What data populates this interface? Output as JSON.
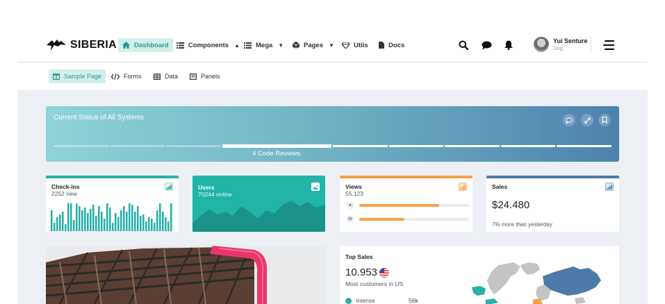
{
  "brand": {
    "name": "SIBERIA"
  },
  "nav": [
    {
      "label": "Dashboard",
      "icon": "home-icon",
      "active": true
    },
    {
      "label": "Components",
      "icon": "list-icon",
      "caret": "up"
    },
    {
      "label": "Mega",
      "icon": "list-icon",
      "caret": "down"
    },
    {
      "label": "Pages",
      "icon": "cube-icon",
      "caret": "down"
    },
    {
      "label": "Utils",
      "icon": "diamond-icon"
    },
    {
      "label": "Docs",
      "icon": "document-icon"
    }
  ],
  "user": {
    "name": "Yui Senture",
    "role": "Dog"
  },
  "subnav": [
    {
      "label": "Sample Page",
      "icon": "columns-icon",
      "active": true
    },
    {
      "label": "Forms",
      "icon": "code-icon"
    },
    {
      "label": "Data",
      "icon": "table-icon"
    },
    {
      "label": "Panels",
      "icon": "panel-icon"
    }
  ],
  "banner": {
    "title": "Current Status of All Systems",
    "progress_label": "4 Code Reviews",
    "steps_total": 10,
    "current_step": 4
  },
  "cards": {
    "checkins": {
      "title": "Check-ins",
      "sub": "2252 new",
      "accent": "#27b0a5"
    },
    "users": {
      "title": "Users",
      "sub": "70244 online",
      "accent": "#22b5a7"
    },
    "views": {
      "title": "Views",
      "sub": "55.123",
      "accent": "#f7a147",
      "rows": [
        {
          "icon": "bmw-icon",
          "value": 0.73
        },
        {
          "icon": "volkswagen-icon",
          "value": 0.41
        }
      ]
    },
    "sales": {
      "title": "Sales",
      "value": "$24.480",
      "note": "7% more than yesterday",
      "accent": "#4d7aa8"
    }
  },
  "top_sales": {
    "title": "Top Sales",
    "value": "10.953",
    "sub": "Most customers in US",
    "legend": [
      {
        "label": "Intense",
        "value": "56k"
      }
    ]
  },
  "colors": {
    "accent": "#27968b",
    "teal": "#22b5a7",
    "orange": "#f7a147",
    "blue": "#4d7aa8"
  }
}
